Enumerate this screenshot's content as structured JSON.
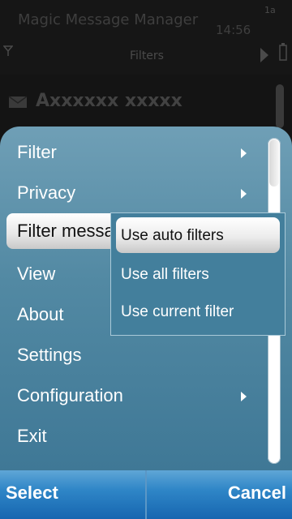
{
  "app": {
    "title": "Magic Message Manager",
    "time": "14:56",
    "view_title": "Filters"
  },
  "background_list": {
    "items": [
      {
        "label": "Axxxxxx xxxxx"
      }
    ]
  },
  "menu": {
    "items": [
      {
        "label": "Filter",
        "has_submenu": true
      },
      {
        "label": "Privacy",
        "has_submenu": true
      },
      {
        "label": "Filter messages",
        "has_submenu": true,
        "highlighted": true
      },
      {
        "label": "View",
        "has_submenu": false
      },
      {
        "label": "About",
        "has_submenu": false
      },
      {
        "label": "Settings",
        "has_submenu": false
      },
      {
        "label": "Configuration",
        "has_submenu": true
      },
      {
        "label": "Exit",
        "has_submenu": false
      }
    ]
  },
  "submenu": {
    "items": [
      {
        "label": "Use auto filters",
        "selected": true
      },
      {
        "label": "Use all filters",
        "selected": false
      },
      {
        "label": "Use current filter",
        "selected": false
      }
    ]
  },
  "softkeys": {
    "left": "Select",
    "right": "Cancel"
  },
  "colors": {
    "menu_bg": "#5289a3",
    "softkey_bg": "#2f86c7",
    "highlight": "#ffffff"
  },
  "icons": {
    "signal": "signal-icon",
    "battery": "battery-icon",
    "keyboard_mode": "input-mode-icon",
    "view_arrow": "arrow-right-icon",
    "list_item": "message-icon"
  }
}
